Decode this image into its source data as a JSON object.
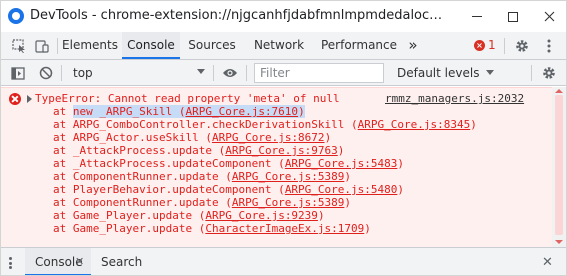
{
  "window": {
    "title": "DevTools - chrome-extension://njgcanhfjdabfmnlmpmdedalocpafnhl/inde..."
  },
  "tabs": [
    {
      "label": "Elements"
    },
    {
      "label": "Console"
    },
    {
      "label": "Sources"
    },
    {
      "label": "Network"
    },
    {
      "label": "Performance"
    }
  ],
  "more_tabs": "»",
  "error_count": "1",
  "toolbar": {
    "context": "top",
    "filter_placeholder": "Filter",
    "levels": "Default levels"
  },
  "error": {
    "message": "TypeError: Cannot read property 'meta' of null",
    "source": "rmmz_managers.js:2032",
    "stack": [
      {
        "at": "at ",
        "fn": "new _ARPG_Skill",
        "open": " (",
        "src": "ARPG_Core.js:7610",
        "close": ")"
      },
      {
        "at": "at ",
        "fn": "ARPG_ComboController.checkDerivationSkill",
        "open": " (",
        "src": "ARPG_Core.js:8345",
        "close": ")"
      },
      {
        "at": "at ",
        "fn": "ARPG_Actor.useSkill",
        "open": " (",
        "src": "ARPG_Core.js:8672",
        "close": ")"
      },
      {
        "at": "at ",
        "fn": "_AttackProcess.update",
        "open": " (",
        "src": "ARPG_Core.js:9763",
        "close": ")"
      },
      {
        "at": "at ",
        "fn": "_AttackProcess.updateComponent",
        "open": " (",
        "src": "ARPG_Core.js:5483",
        "close": ")"
      },
      {
        "at": "at ",
        "fn": "ComponentRunner.update",
        "open": " (",
        "src": "ARPG_Core.js:5389",
        "close": ")"
      },
      {
        "at": "at ",
        "fn": "PlayerBehavior.updateComponent",
        "open": " (",
        "src": "ARPG_Core.js:5480",
        "close": ")"
      },
      {
        "at": "at ",
        "fn": "ComponentRunner.update",
        "open": " (",
        "src": "ARPG_Core.js:5389",
        "close": ")"
      },
      {
        "at": "at ",
        "fn": "Game_Player.update",
        "open": " (",
        "src": "ARPG_Core.js:9239",
        "close": ")"
      },
      {
        "at": "at ",
        "fn": "Game_Player.update",
        "open": " (",
        "src": "CharacterImageEx.js:1709",
        "close": ")"
      }
    ]
  },
  "drawer": {
    "tabs": [
      {
        "label": "Console"
      },
      {
        "label": "Search"
      }
    ]
  },
  "colors": {
    "accent": "#1a73e8",
    "error_text": "#e0201c",
    "error_bg": "#fff0f0"
  }
}
